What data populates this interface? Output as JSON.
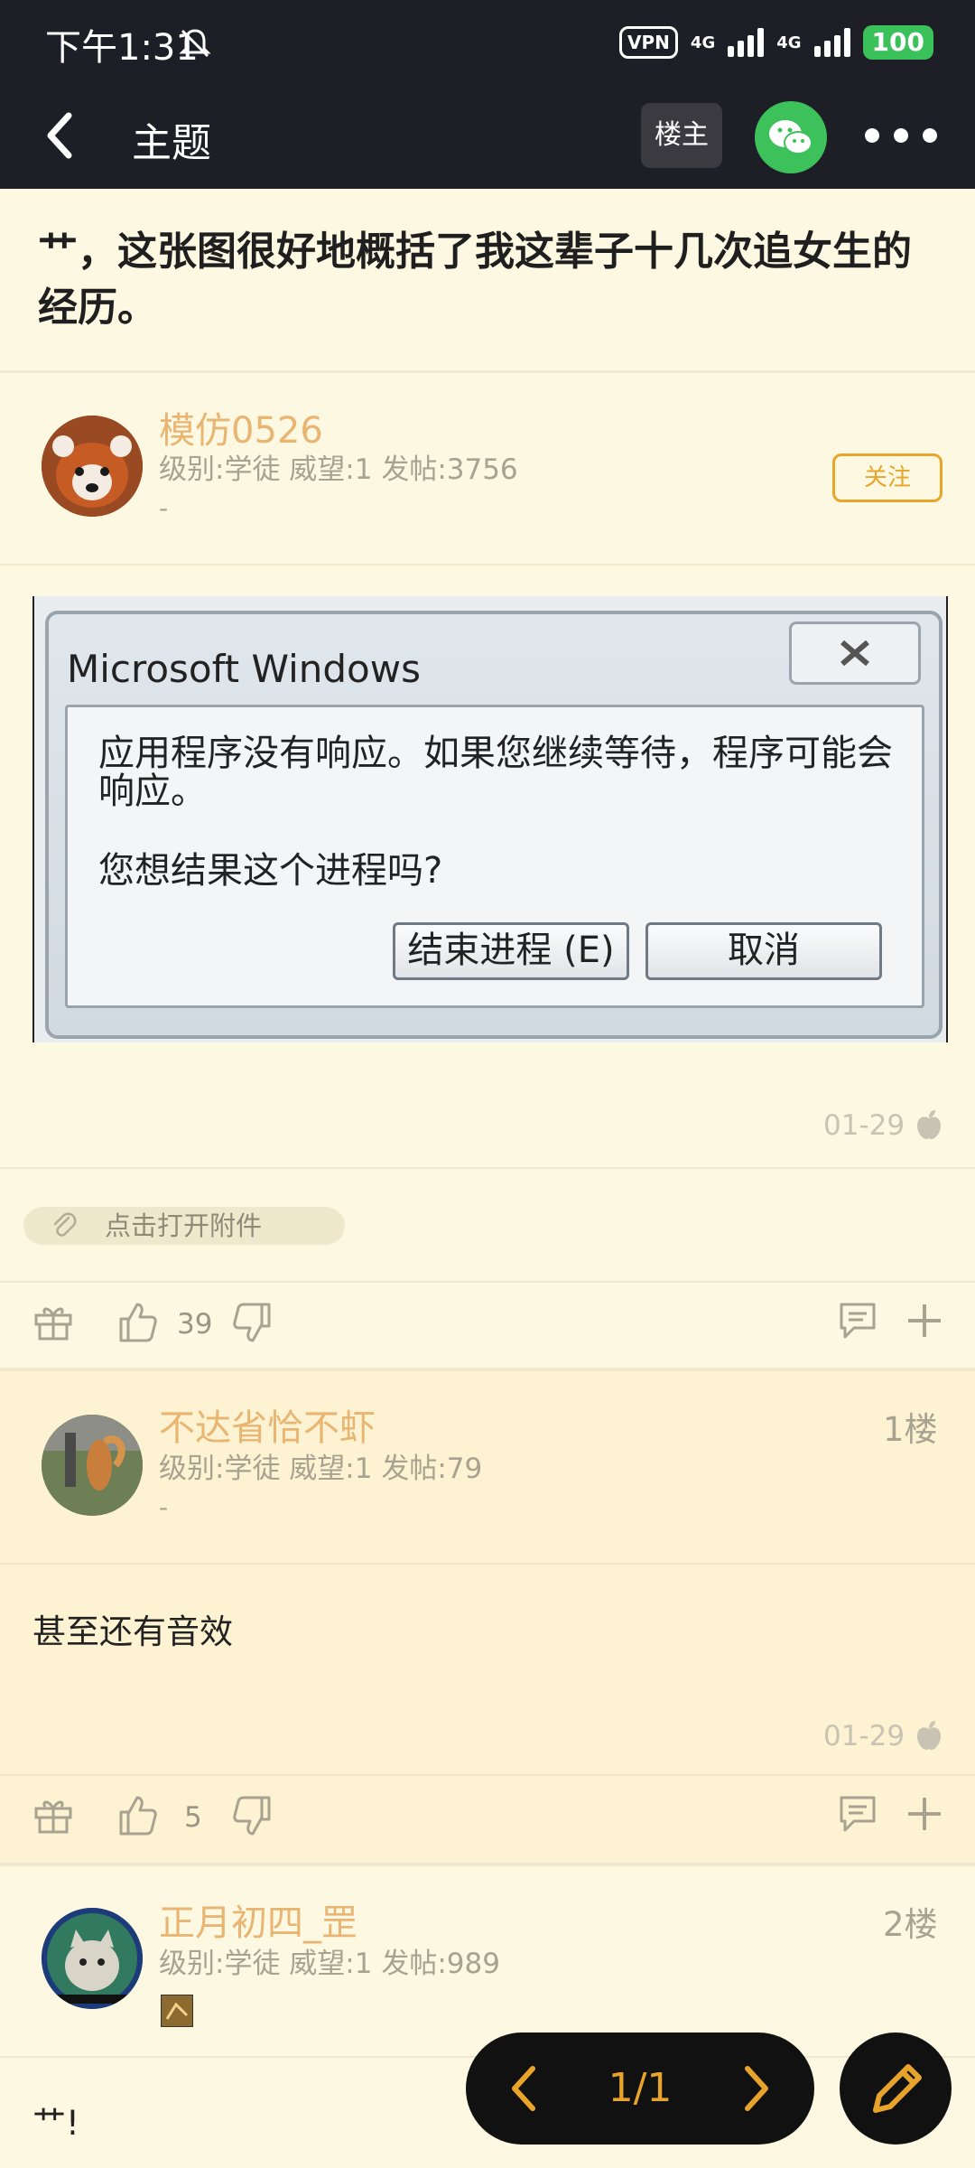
{
  "status": {
    "time": "下午1:31",
    "vpn": "VPN",
    "net1": "4G",
    "net2": "4G",
    "battery": "100"
  },
  "topbar": {
    "title": "主题",
    "owner_label": "楼主"
  },
  "thread": {
    "title": "艹，这张图很好地概括了我这辈子十几次追女生的经历。"
  },
  "op": {
    "username": "模仿0526",
    "meta": "级别:学徒 威望:1 发帖:3756",
    "signature": "-",
    "follow_label": "关注",
    "image": {
      "window_title": "Microsoft Windows",
      "message": "应用程序没有响应。如果您继续等待，程序可能会响应。",
      "question": "您想结果这个进程吗?",
      "end_button": "结束进程 (E)",
      "cancel_button": "取消"
    },
    "timestamp": "01-29",
    "attachment_label": "点击打开附件",
    "likes": "39"
  },
  "replies": [
    {
      "username": "不达省恰不虾",
      "meta": "级别:学徒 威望:1 发帖:79",
      "signature": "-",
      "floor": "1楼",
      "text": "甚至还有音效",
      "timestamp": "01-29",
      "likes": "5"
    },
    {
      "username": "正月初四_罡",
      "meta": "级别:学徒 威望:1 发帖:989",
      "floor": "2楼",
      "text": "艹!"
    }
  ],
  "pager": {
    "text": "1/1"
  },
  "colors": {
    "accent": "#e8a42a",
    "username": "#e8b572",
    "background": "#fdf8e2",
    "dark": "#1e1e26",
    "wechat": "#3dc15a"
  }
}
